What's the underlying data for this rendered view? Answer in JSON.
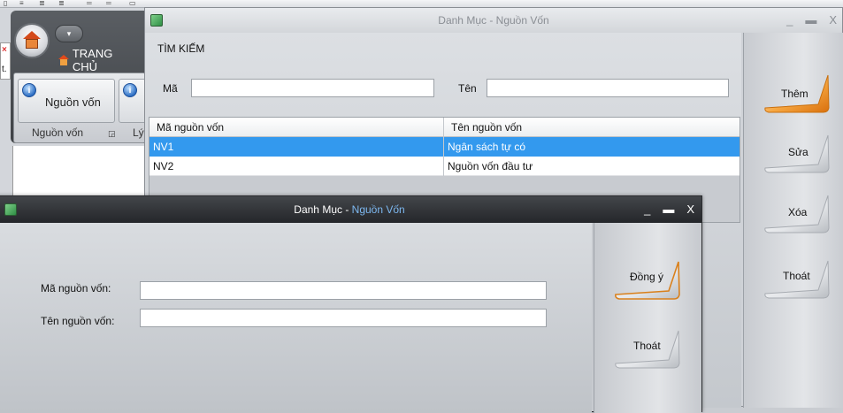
{
  "background_app": {
    "ribbon_tab": "TRANG CHỦ",
    "ribbon_button_1": "Nguồn vốn",
    "ribbon_group_1": "Nguồn vốn",
    "ribbon_group_2_partial": "Lý"
  },
  "list_window": {
    "title": "Danh Mục - Nguồn Vốn",
    "search_section_title": "TÌM KIẾM",
    "code_label": "Mã",
    "code_value": "",
    "name_label": "Tên",
    "name_value": "",
    "grid": {
      "columns": [
        "Mã nguồn vốn",
        "Tên nguồn vốn"
      ],
      "rows": [
        {
          "code": "NV1",
          "name": "Ngân sách tự có",
          "selected": true
        },
        {
          "code": "NV2",
          "name": "Nguồn vốn đầu tư",
          "selected": false
        }
      ]
    },
    "actions": {
      "add": "Thêm",
      "edit": "Sửa",
      "delete": "Xóa",
      "exit": "Thoát"
    },
    "highlight_action": "add"
  },
  "edit_window": {
    "title_prefix": "Danh Mục - ",
    "title_highlight": "Nguồn Vốn",
    "code_label": "Mã nguồn vốn:",
    "code_value": "",
    "name_label": "Tên nguồn vốn:",
    "name_value": "",
    "actions": {
      "ok": "Đồng ý",
      "exit": "Thoát"
    },
    "highlight_action": "ok"
  },
  "window_controls": {
    "minimize": "_",
    "maximize": "▬",
    "close": "X"
  },
  "colors": {
    "selection": "#3399ee",
    "accent_orange": "#f08a1c",
    "title_highlight": "#7db8f0"
  }
}
